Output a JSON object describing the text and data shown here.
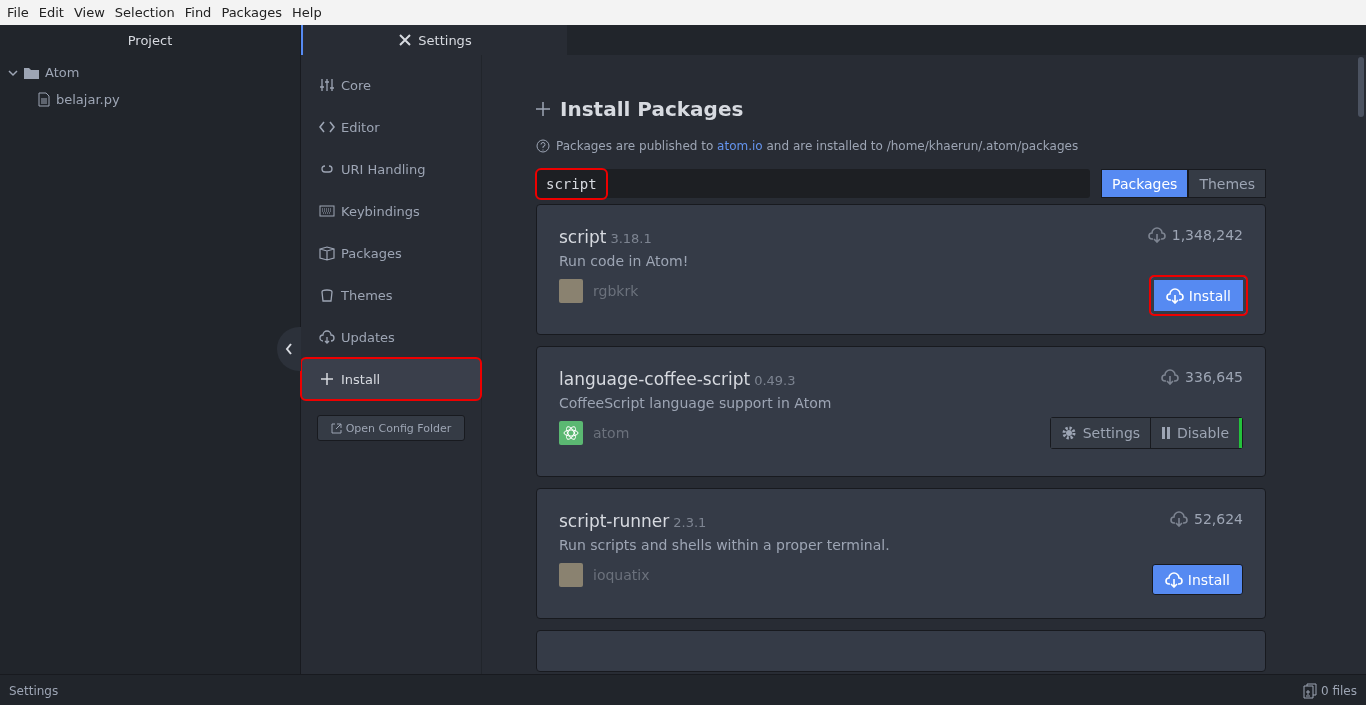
{
  "menu_bar": [
    "File",
    "Edit",
    "View",
    "Selection",
    "Find",
    "Packages",
    "Help"
  ],
  "project_panel": {
    "title": "Project",
    "tree": [
      {
        "label": "Atom",
        "kind": "folder",
        "expanded": true,
        "children": [
          {
            "label": "belajar.py",
            "kind": "file"
          }
        ]
      }
    ]
  },
  "tabs": [
    {
      "label": "Settings",
      "selected": true
    }
  ],
  "settings_nav": [
    {
      "label": "Core",
      "selected": false,
      "highlighted": false
    },
    {
      "label": "Editor",
      "selected": false,
      "highlighted": false
    },
    {
      "label": "URI Handling",
      "selected": false,
      "highlighted": false
    },
    {
      "label": "Keybindings",
      "selected": false,
      "highlighted": false
    },
    {
      "label": "Packages",
      "selected": false,
      "highlighted": false
    },
    {
      "label": "Themes",
      "selected": false,
      "highlighted": false
    },
    {
      "label": "Updates",
      "selected": false,
      "highlighted": false
    },
    {
      "label": "Install",
      "selected": true,
      "highlighted": true
    }
  ],
  "open_config_button": "Open Config Folder",
  "install": {
    "title": "Install Packages",
    "info_parts": [
      "Packages are published to ",
      "atom.io",
      " and are installed to /home/khaerun/.atom/packages"
    ],
    "search": {
      "value": "script",
      "highlighted": true
    },
    "scope_toggle": [
      {
        "label": "Packages",
        "selected": true
      },
      {
        "label": "Themes",
        "selected": false
      }
    ],
    "packages": [
      {
        "name": "script",
        "version": "3.18.1",
        "description": "Run code in Atom!",
        "author": "rgbkrk",
        "downloads": "1,348,242",
        "kind": "install",
        "buttons": [
          "Install"
        ],
        "highlighted": true
      },
      {
        "name": "language-coffee-script",
        "version": "0.49.3",
        "description": "CoffeeScript language support in Atom",
        "author": "atom",
        "downloads": "336,645",
        "kind": "installed",
        "buttons": [
          "Settings",
          "Disable"
        ],
        "highlighted": false
      },
      {
        "name": "script-runner",
        "version": "2.3.1",
        "description": "Run scripts and shells within a proper terminal.",
        "author": "ioquatix",
        "downloads": "52,624",
        "kind": "install",
        "buttons": [
          "Install"
        ],
        "highlighted": false
      }
    ]
  },
  "status_bar": {
    "left": "Settings",
    "right": "0 files"
  }
}
